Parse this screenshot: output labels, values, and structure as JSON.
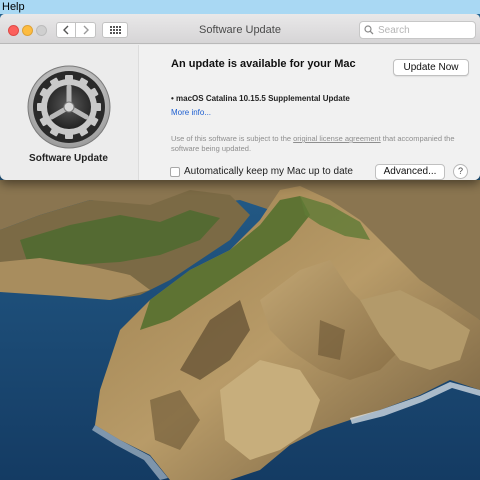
{
  "menubar": {
    "help_label": "Help"
  },
  "window": {
    "title": "Software Update",
    "search": {
      "placeholder": "Search",
      "value": ""
    },
    "nav": {
      "back_icon": "chevron-left-icon",
      "forward_icon": "chevron-right-icon",
      "grid_icon": "show-all-grid-icon"
    },
    "traffic_lights": {
      "close": "#fc605c",
      "minimize": "#fdbc40",
      "zoom": "#cfcfcf"
    }
  },
  "sidebar": {
    "app_icon": "gear-icon",
    "app_name": "Software Update"
  },
  "content": {
    "headline": "An update is available for your Mac",
    "update_now_label": "Update Now",
    "update_item": "• macOS Catalina 10.15.5 Supplemental Update",
    "more_info_label": "More info...",
    "license_prefix": "Use of this software is subject to the ",
    "license_link": "original license agreement",
    "license_suffix": " that accompanied the software being updated.",
    "auto_update_label": "Automatically keep my Mac up to date",
    "auto_update_checked": false,
    "advanced_label": "Advanced...",
    "help_label": "?"
  },
  "colors": {
    "accent_link": "#1e5fd0",
    "menubar": "#a9d8f3",
    "window_bg": "#ececec"
  }
}
